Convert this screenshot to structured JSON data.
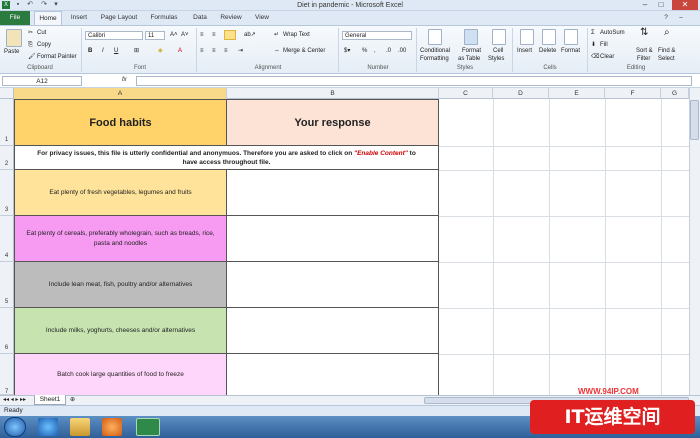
{
  "window": {
    "title": "Diet in pandemic - Microsoft Excel"
  },
  "ribbon_tabs": [
    "File",
    "Home",
    "Insert",
    "Page Layout",
    "Formulas",
    "Data",
    "Review",
    "View"
  ],
  "clipboard": {
    "paste": "Paste",
    "cut": "Cut",
    "copy": "Copy",
    "format_painter": "Format Painter",
    "label": "Clipboard"
  },
  "font": {
    "name": "Calibri",
    "size": "11",
    "label": "Font"
  },
  "alignment": {
    "wrap": "Wrap Text",
    "merge": "Merge & Center",
    "label": "Alignment"
  },
  "number": {
    "format": "General",
    "label": "Number"
  },
  "styles": {
    "conditional": "Conditional",
    "conditional2": "Formatting",
    "format_table": "Format",
    "format_table2": "as Table",
    "cell_styles": "Cell",
    "cell_styles2": "Styles",
    "label": "Styles"
  },
  "cells": {
    "insert": "Insert",
    "delete": "Delete",
    "format": "Format",
    "label": "Cells"
  },
  "editing": {
    "autosum": "AutoSum",
    "fill": "Fill",
    "clear": "Clear",
    "sort": "Sort &",
    "sort2": "Filter",
    "find": "Find &",
    "find2": "Select",
    "label": "Editing"
  },
  "formula_bar": {
    "name_box": "A12",
    "fx": "fx"
  },
  "columns": [
    "A",
    "B",
    "C",
    "D",
    "E",
    "F",
    "G"
  ],
  "rows": [
    "1",
    "2",
    "3",
    "4",
    "5",
    "6",
    "7"
  ],
  "sheet": {
    "header_a": "Food habits",
    "header_b": "Your response",
    "privacy_pre": "For privacy issues, this file is utterly confidential and anonymuos. Therefore you are asked to click on ",
    "privacy_link": "\"Enable Content\"",
    "privacy_post": " to have access throughout file.",
    "items": [
      "Eat plenty of fresh vegetables, legumes and fruits",
      "Eat plenty of cereals, preferably wholegrain, such as breads, rice, pasta and noodles",
      "Include lean meat, fish, poultry and/or alternatives",
      "Include milks, yoghurts, cheeses and/or alternatives",
      "Batch cook large quantities of food to freeze"
    ]
  },
  "sheet_tab": "Sheet1",
  "status": "Ready",
  "watermark": {
    "url": "WWW.94IP.COM",
    "text": "IT运维空间"
  },
  "colors": {
    "header_a": "#ffd36a",
    "header_b": "#fde3d6",
    "row3": "#ffe39a",
    "row4": "#f79af2",
    "row5": "#bcbcbc",
    "row6": "#c6e3b0",
    "row7": "#ffd6fb",
    "file_tab": "#2b7a3e",
    "link": "#cc0000"
  }
}
